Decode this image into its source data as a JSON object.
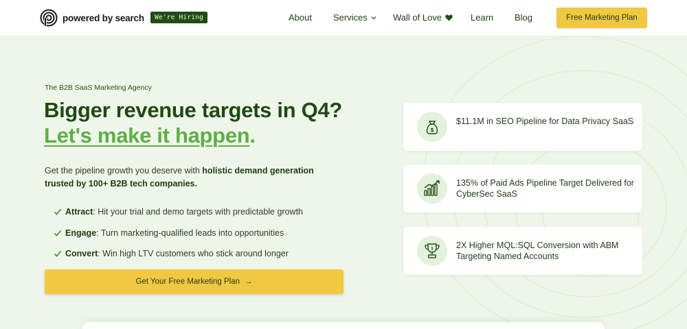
{
  "brand": {
    "name": "powered by search",
    "hiring_badge": "We're Hiring"
  },
  "nav": {
    "items": [
      {
        "label": "About"
      },
      {
        "label": "Services"
      },
      {
        "label": "Wall of Love"
      },
      {
        "label": "Learn"
      },
      {
        "label": "Blog"
      }
    ],
    "cta": "Free Marketing Plan"
  },
  "hero": {
    "eyebrow": "The B2B SaaS Marketing Agency",
    "headline_line1": "Bigger revenue targets in Q4?",
    "headline_line2_link": "Let's make it happen",
    "headline_line2_period": ".",
    "intro_plain": "Get the pipeline growth you deserve with ",
    "intro_bold": "holistic demand generation trusted by 100+ B2B tech companies.",
    "bullets": [
      {
        "bold": "Attract",
        "text": ": Hit your trial and demo targets with predictable growth"
      },
      {
        "bold": "Engage",
        "text": ": Turn marketing-qualified leads into opportunities"
      },
      {
        "bold": "Convert",
        "text": ": Win high LTV customers who stick around longer"
      }
    ],
    "cta": "Get Your Free Marketing Plan",
    "cta_arrow": "→"
  },
  "stats": [
    {
      "icon": "money-bag-icon",
      "text": "$11.1M in SEO Pipeline for Data Privacy SaaS"
    },
    {
      "icon": "growth-chart-icon",
      "text": "135% of Paid Ads Pipeline Target Delivered for CyberSec SaaS"
    },
    {
      "icon": "trophy-icon",
      "text": "2X Higher MQL:SQL Conversion with ABM Targeting Named Accounts"
    }
  ],
  "colors": {
    "background": "#eef6ea",
    "dark_green": "#1e4a12",
    "accent_green": "#5fae46",
    "cta_yellow": "#f1c842"
  }
}
